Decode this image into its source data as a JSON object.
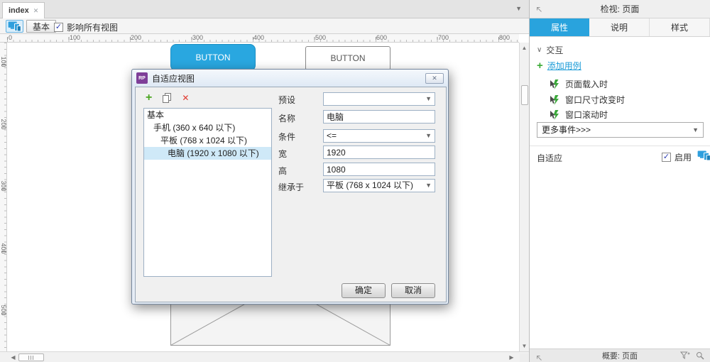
{
  "colors": {
    "accent": "#29a3dd",
    "green": "#3aaa35",
    "red": "#e0392f",
    "purple": "#7e3f98",
    "selection": "#cfe9f8"
  },
  "tabbar": {
    "tab_label": "index"
  },
  "toolbar": {
    "base_button": "基本",
    "affect_all_label": "影响所有视图",
    "affect_all_checked": true
  },
  "rulers": {
    "h": [
      "0",
      "100",
      "200",
      "300",
      "400",
      "500",
      "600",
      "700",
      "800"
    ],
    "v": [
      "100",
      "200",
      "300",
      "400",
      "500"
    ]
  },
  "canvas": {
    "primary_button_label": "BUTTON",
    "secondary_button_label": "BUTTON"
  },
  "dialog": {
    "title": "自适应视图",
    "icon_text": "RP",
    "list": [
      {
        "label": "基本",
        "selected": false
      },
      {
        "label": "手机 (360 x 640 以下)",
        "selected": false
      },
      {
        "label": "平板 (768 x 1024 以下)",
        "selected": false
      },
      {
        "label": "电脑 (1920 x 1080 以下)",
        "selected": true
      }
    ],
    "form": {
      "preset_label": "预设",
      "preset_value": "",
      "name_label": "名称",
      "name_value": "电脑",
      "condition_label": "条件",
      "condition_value": "<=",
      "width_label": "宽",
      "width_value": "1920",
      "height_label": "高",
      "height_value": "1080",
      "inherit_label": "继承于",
      "inherit_value": "平板 (768 x 1024 以下)"
    },
    "ok_label": "确定",
    "cancel_label": "取消"
  },
  "inspector": {
    "header_title": "检视: 页面",
    "tabs": [
      {
        "label": "属性",
        "active": true
      },
      {
        "label": "说明",
        "active": false
      },
      {
        "label": "样式",
        "active": false
      }
    ],
    "interaction_section_label": "交互",
    "add_case_label": "添加用例",
    "events": [
      "页面载入时",
      "窗口尺寸改变时",
      "窗口滚动时"
    ],
    "more_events_label": "更多事件>>>",
    "adaptive_label": "自适应",
    "enable_label": "启用",
    "footer_title": "概要: 页面"
  }
}
